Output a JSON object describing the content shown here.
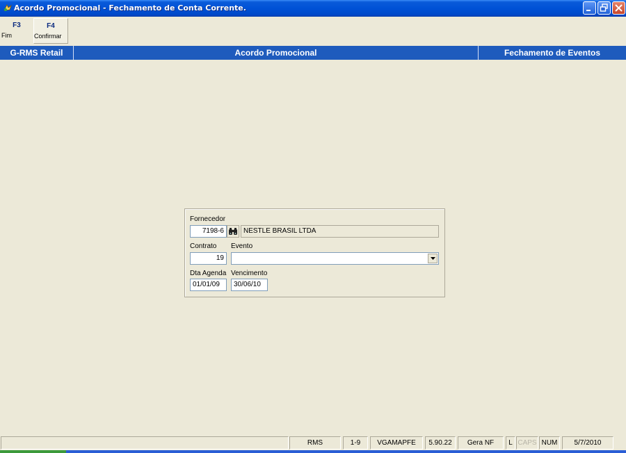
{
  "window": {
    "title": "Acordo Promocional - Fechamento de Conta Corrente.",
    "icon": "app-icon",
    "controls": [
      "minimize-icon",
      "restore-icon",
      "close-icon"
    ]
  },
  "toolbar": {
    "fim": {
      "key": "F3",
      "label": "Fim"
    },
    "confirmar": {
      "key": "F4",
      "label": "Confirmar"
    }
  },
  "header": {
    "left": "G-RMS Retail",
    "center": "Acordo Promocional",
    "right": "Fechamento de Eventos"
  },
  "form": {
    "fornecedor_label": "Fornecedor",
    "fornecedor_code": "7198-6",
    "search_icon": "binoculars-icon",
    "fornecedor_name": "NESTLE BRASIL LTDA",
    "contrato_label": "Contrato",
    "contrato_value": "19",
    "evento_label": "Evento",
    "evento_value": "",
    "dta_agenda_label": "Dta Agenda",
    "dta_agenda_value": "01/01/09",
    "vencimento_label": "Vencimento",
    "vencimento_value": "30/06/10"
  },
  "statusbar": {
    "cells": [
      "RMS",
      "1-9",
      "VGAMAPFE",
      "5.90.22",
      "Gera NF",
      "L",
      "CAPS",
      "NUM",
      "5/7/2010"
    ]
  }
}
